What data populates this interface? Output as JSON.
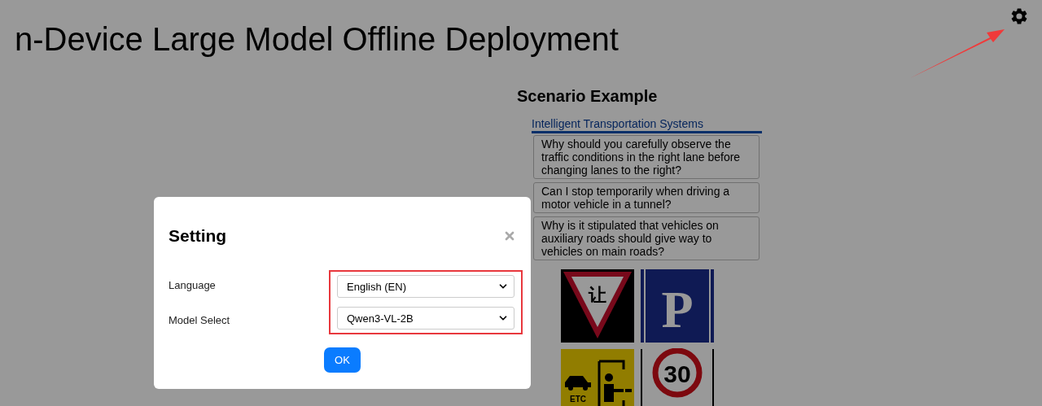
{
  "page": {
    "title": "n-Device Large Model Offline Deployment"
  },
  "scenario": {
    "heading": "Scenario Example",
    "tabs": [
      {
        "label": "Intelligent Transportation Systems",
        "selected": true
      }
    ],
    "questions": [
      "Why should you carefully observe the traffic conditions in the right lane before changing lanes to the right?",
      "Can I stop temporarily when driving a motor vehicle in a tunnel?",
      "Why is it stipulated that vehicles on auxiliary roads should give way to vehicles on main roads?"
    ],
    "signs": [
      {
        "kind": "yield",
        "text": "让"
      },
      {
        "kind": "parking",
        "text": "P"
      },
      {
        "kind": "etc",
        "text": "ETC"
      },
      {
        "kind": "speed",
        "text": "30"
      }
    ]
  },
  "dialog": {
    "title": "Setting",
    "fields": [
      {
        "label": "Language",
        "value": "English (EN)"
      },
      {
        "label": "Model Select",
        "value": "Qwen3-VL-2B"
      }
    ],
    "ok": "OK"
  }
}
